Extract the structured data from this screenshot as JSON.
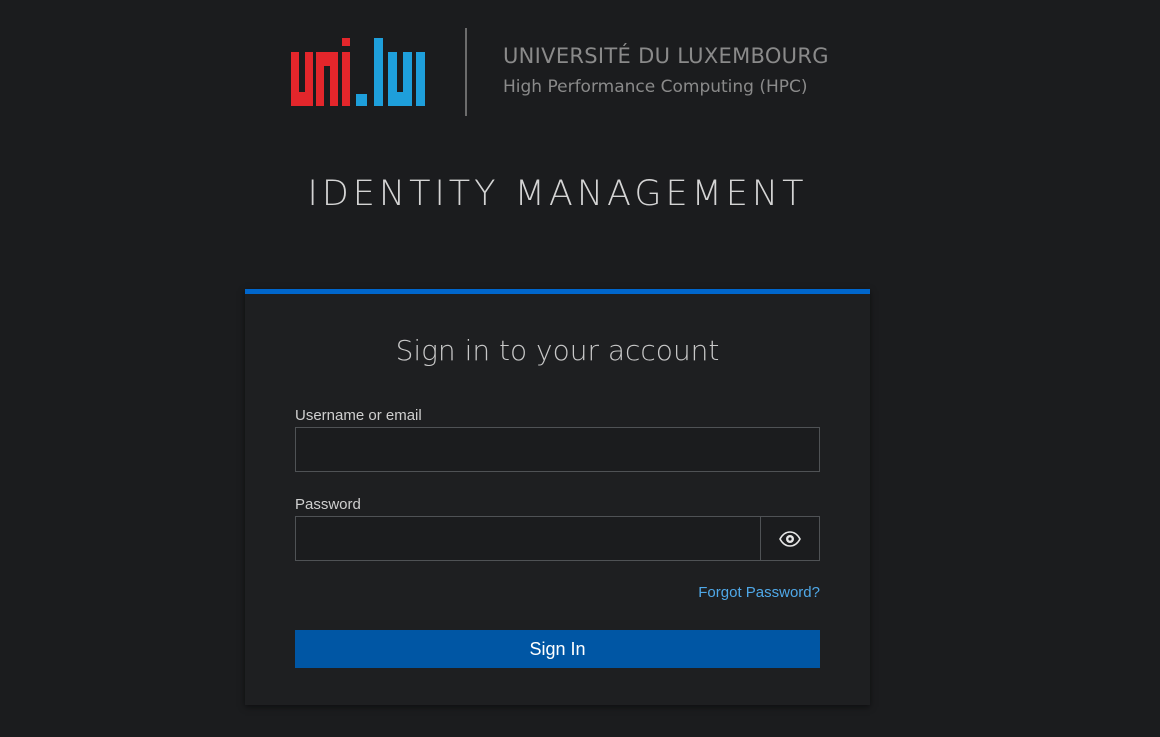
{
  "header": {
    "logo_text": "uni.lu",
    "university_name": "UNIVERSITÉ DU LUXEMBOURG",
    "department": "High Performance Computing (HPC)",
    "page_title": "IDENTITY MANAGEMENT"
  },
  "login": {
    "title": "Sign in to your account",
    "username_label": "Username or email",
    "username_value": "",
    "password_label": "Password",
    "password_value": "",
    "forgot_password": "Forgot Password?",
    "submit_label": "Sign In"
  },
  "colors": {
    "background": "#1b1c1e",
    "accent": "#0066cc",
    "button": "#0056a4",
    "link": "#4fa8e8",
    "logo_red": "#e3262b",
    "logo_blue": "#1e9fdb"
  },
  "icons": {
    "show_password": "eye-icon"
  }
}
